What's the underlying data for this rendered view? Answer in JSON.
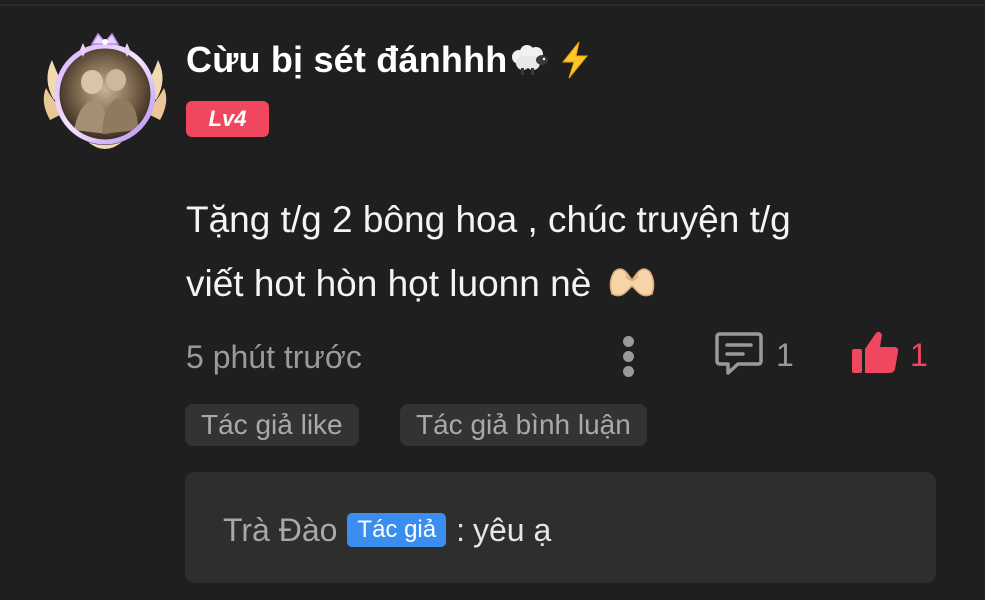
{
  "comment": {
    "username": "Cừu bị sét đánhhh",
    "username_icons": [
      "sheep-icon",
      "lightning-icon"
    ],
    "level": "Lv4",
    "text_line1": "Tặng t/g 2 bông hoa , chúc truyện t/g",
    "text_line2": "viết hot hòn họt luonn nè",
    "text_icon": "heart-hands-icon",
    "timestamp": "5 phút trước",
    "reply_count": "1",
    "like_count": "1",
    "tags": [
      "Tác giả like",
      "Tác giả bình luận"
    ]
  },
  "reply": {
    "author": "Trà Đào",
    "author_badge": "Tác giả",
    "separator": ":",
    "text": "yêu ạ"
  },
  "colors": {
    "background": "#1f1f1f",
    "accent_red": "#f0465f",
    "badge_blue": "#3b8ef0",
    "muted_text": "#9a9a9a",
    "chip_bg": "#333333",
    "reply_bg": "#2e2e2e"
  }
}
